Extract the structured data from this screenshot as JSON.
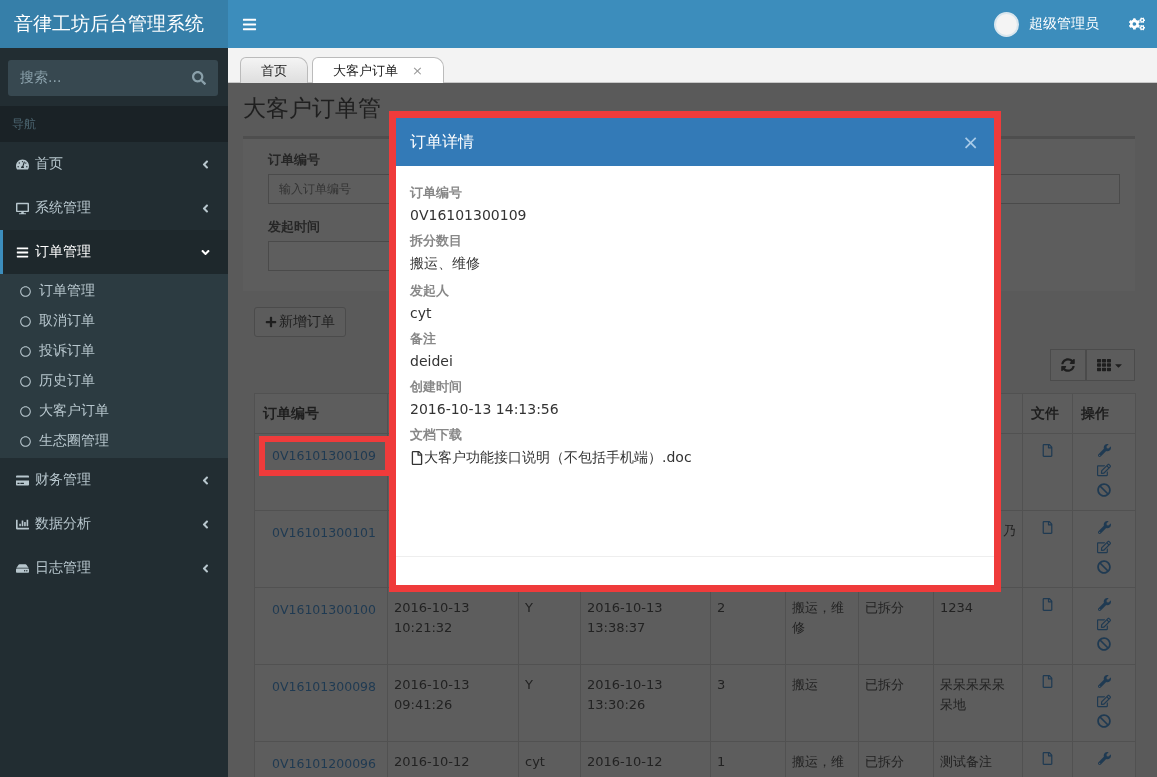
{
  "app": {
    "title": "音律工坊后台管理系统"
  },
  "header": {
    "user": "超级管理员"
  },
  "sidebar": {
    "search_placeholder": "搜索...",
    "nav_heading": "导航",
    "items": [
      {
        "label": "首页",
        "expanded": false
      },
      {
        "label": "系统管理",
        "expanded": false
      },
      {
        "label": "订单管理",
        "expanded": true,
        "children": [
          {
            "label": "订单管理"
          },
          {
            "label": "取消订单"
          },
          {
            "label": "投诉订单"
          },
          {
            "label": "历史订单"
          },
          {
            "label": "大客户订单"
          },
          {
            "label": "生态圈管理"
          }
        ]
      },
      {
        "label": "财务管理",
        "expanded": false
      },
      {
        "label": "数据分析",
        "expanded": false
      },
      {
        "label": "日志管理",
        "expanded": false
      }
    ]
  },
  "tabs": [
    {
      "label": "首页",
      "selected": false
    },
    {
      "label": "大客户订单",
      "selected": true,
      "close": "×"
    }
  ],
  "page": {
    "title": "大客户订单管",
    "filters": [
      {
        "kind": "labeled",
        "label": "订单编号",
        "placeholder": "输入订单编号"
      },
      {
        "kind": "bare"
      },
      {
        "kind": "labeled",
        "label": "发起时间"
      }
    ],
    "add_button": "新增订单"
  },
  "table": {
    "columns": {
      "column_1": "订单编号",
      "column_9": "文件",
      "column_10": "操作"
    },
    "rows": [
      {
        "order_id": "0V16101300109",
        "highlighted": true
      },
      {
        "order_id": "0V16101300101",
        "highlighted": false,
        "column_8": "乃"
      },
      {
        "order_id": "0V16101300100",
        "highlighted": false,
        "column_2": "2016-10-13 10:21:32",
        "column_3": "Y",
        "column_4": "2016-10-13 13:38:37",
        "column_5": "2",
        "column_6": "搬运，维修",
        "column_7": "已拆分",
        "column_8": "1234"
      },
      {
        "order_id": "0V16101300098",
        "highlighted": false,
        "column_2": "2016-10-13 09:41:26",
        "column_3": "Y",
        "column_4": "2016-10-13 13:30:26",
        "column_5": "3",
        "column_6": "搬运",
        "column_7": "已拆分",
        "column_8": "呆呆呆呆呆呆地"
      },
      {
        "order_id": "0V16101200096",
        "highlighted": false,
        "column_2": "2016-10-12",
        "column_3": "cyt",
        "column_4": "2016-10-12",
        "column_5": "1",
        "column_6": "搬运，维",
        "column_7": "已拆分",
        "column_8": "测试备注"
      }
    ]
  },
  "modal": {
    "title": "订单详情",
    "close": "×",
    "highlighted": true,
    "fields": [
      {
        "kind": "text",
        "label": "订单编号",
        "value": "0V16101300109"
      },
      {
        "kind": "text",
        "label": "拆分数目",
        "value": "搬运、维修"
      },
      {
        "kind": "text",
        "label": "发起人",
        "value": "cyt"
      },
      {
        "kind": "text",
        "label": "备注",
        "value": "deidei"
      },
      {
        "kind": "text",
        "label": "创建时间",
        "value": "2016-10-13 14:13:56"
      },
      {
        "kind": "file",
        "label": "文档下载",
        "value": "大客户功能接口说明（不包括手机端）.doc"
      }
    ]
  }
}
